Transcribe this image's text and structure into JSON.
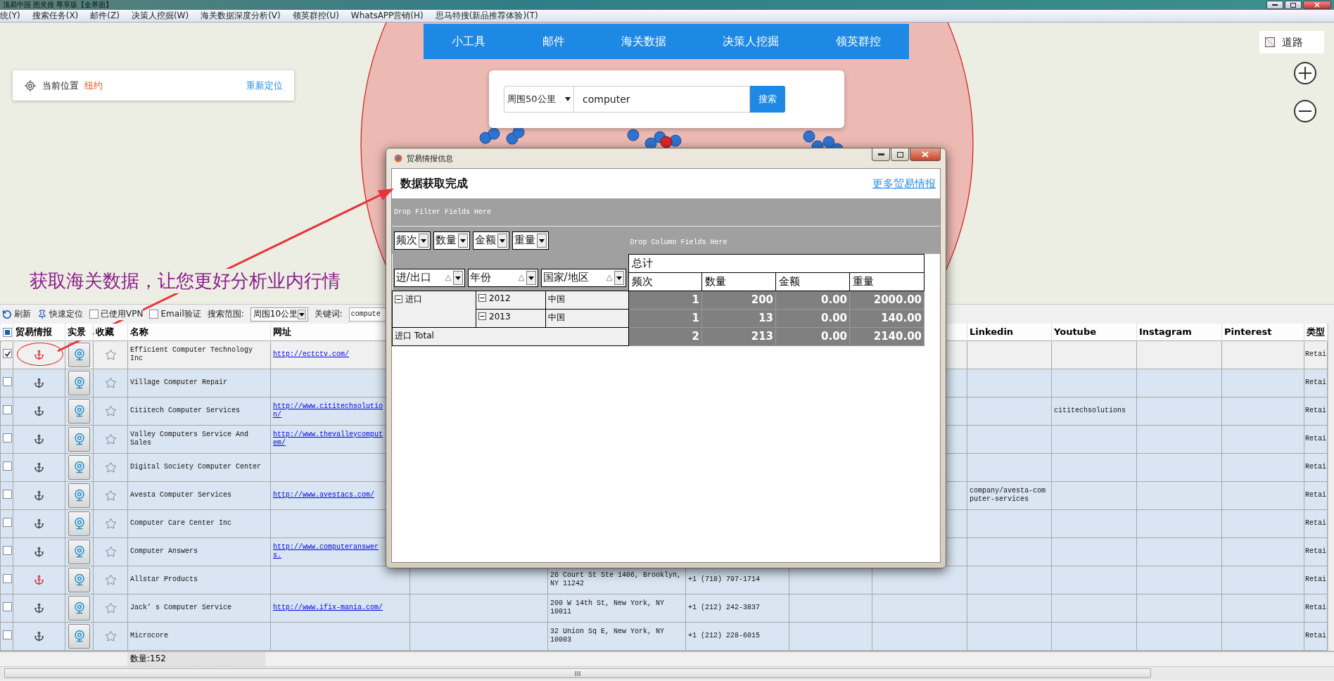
{
  "window": {
    "title": "顶易中国 图灵搜 尊享版【全界面】"
  },
  "menu": [
    "统(Y)",
    "搜索任务(X)",
    "邮件(Z)",
    "决策人挖掘(W)",
    "海关数据深度分析(V)",
    "领英群控(U)",
    "WhatsAPP营销(H)",
    "思马特搜(新品推荐体验)(T)"
  ],
  "map": {
    "nav_tabs": [
      "小工具",
      "邮件",
      "海关数据",
      "决策人挖掘",
      "领英群控"
    ],
    "location": {
      "label": "当前位置",
      "city": "纽约",
      "action": "重新定位"
    },
    "search": {
      "radius": "周围50公里",
      "query": "computer",
      "button": "搜索"
    },
    "layer_toggle": "道路",
    "annotation": "获取海关数据，让您更好分析业内行情"
  },
  "toolbar": {
    "refresh": "刷新",
    "locate": "快速定位",
    "options": [
      {
        "label": "已使用VPN",
        "checked": false
      },
      {
        "label": "Email验证",
        "checked": false
      }
    ],
    "range_label": "搜索范围:",
    "range": "周围10公里",
    "keyword_label": "关键词:",
    "keyword": "compute"
  },
  "table": {
    "select_all_partial": true,
    "columns": [
      {
        "label": "贸易情报"
      },
      {
        "label": "实景"
      },
      {
        "label": "收藏"
      },
      {
        "label": "名称"
      },
      {
        "label": "网址"
      },
      {},
      {},
      {},
      {},
      {},
      {
        "label": "Linkedin"
      },
      {
        "label": "Youtube"
      },
      {
        "label": "Instagram"
      },
      {
        "label": "Pinterest"
      },
      {
        "label": "类型"
      }
    ],
    "rows": [
      {
        "checked": true,
        "selected": true,
        "highlighted": true,
        "trade_data": true,
        "name": "Efficient Computer Technology Inc",
        "url": "http://ectctv.com/",
        "type": "Retai"
      },
      {
        "checked": false,
        "selected": false,
        "highlighted": false,
        "trade_data": false,
        "name": "Village Computer Repair",
        "type": "Retai"
      },
      {
        "checked": false,
        "selected": false,
        "highlighted": false,
        "trade_data": false,
        "name": "Cititech Computer Services",
        "url": "http://www.cititechsolution/",
        "youtube": "cititechsolutions",
        "type": "Retai"
      },
      {
        "checked": false,
        "selected": false,
        "highlighted": false,
        "trade_data": false,
        "name": "Valley Computers Service And Sales",
        "url": "http://www.thevalleycomputem/",
        "type": "Retai"
      },
      {
        "checked": false,
        "selected": false,
        "highlighted": false,
        "trade_data": false,
        "name": "Digital Society Computer Center",
        "type": "Retai"
      },
      {
        "checked": false,
        "selected": false,
        "highlighted": false,
        "trade_data": false,
        "name": "Avesta Computer Services",
        "url": "http://www.avestacs.com/",
        "linkedin": "company/avesta-computer-services",
        "type": "Retai"
      },
      {
        "checked": false,
        "selected": false,
        "highlighted": false,
        "trade_data": false,
        "name": "Computer Care Center Inc",
        "type": "Retai"
      },
      {
        "checked": false,
        "selected": false,
        "highlighted": false,
        "trade_data": false,
        "name": "Computer Answers",
        "url": "http://www.computeranswers.",
        "type": "Retai"
      },
      {
        "checked": false,
        "selected": false,
        "highlighted": false,
        "trade_data": true,
        "name": "Allstar Products",
        "address": "26 Court St Ste 1406, Brooklyn, NY 11242",
        "phone": "+1 (718) 797-1714",
        "type": "Retai"
      },
      {
        "checked": false,
        "selected": false,
        "highlighted": false,
        "trade_data": false,
        "name": "Jack’ s Computer Service",
        "url": "http://www.ifix-mania.com/",
        "address": "200 W 14th St, New York, NY 10011",
        "phone": "+1 (212) 242-3837",
        "type": "Retai"
      },
      {
        "checked": false,
        "selected": false,
        "highlighted": false,
        "trade_data": false,
        "name": "Microcore",
        "address": "32 Union Sq E, New York, NY 10003",
        "phone": "+1 (212) 228-6015",
        "type": "Retai"
      }
    ],
    "footer": "数量:152"
  },
  "dialog": {
    "title": "贸易情报信息",
    "status": "数据获取完成",
    "link": "更多贸易情报",
    "filter_hint": "Drop Filter Fields Here",
    "column_hint": "Drop Column Fields Here",
    "data_fields": [
      "频次",
      "数量",
      "金额",
      "重量"
    ],
    "row_fields": [
      "进/出口",
      "年份",
      "国家/地区"
    ],
    "grand_total": "总计",
    "value_headers": [
      "频次",
      "数量",
      "金额",
      "重量"
    ],
    "groups": [
      {
        "label": "进口",
        "expanded": true,
        "rows": [
          {
            "year": "2012",
            "expanded": true,
            "country": "中国",
            "values": [
              "1",
              "200",
              "0.00",
              "2000.00"
            ]
          },
          {
            "year": "2013",
            "expanded": true,
            "country": "中国",
            "values": [
              "1",
              "13",
              "0.00",
              "140.00"
            ]
          }
        ],
        "total_label": "进口 Total",
        "total": [
          "2",
          "213",
          "0.00",
          "2140.00"
        ]
      }
    ]
  }
}
